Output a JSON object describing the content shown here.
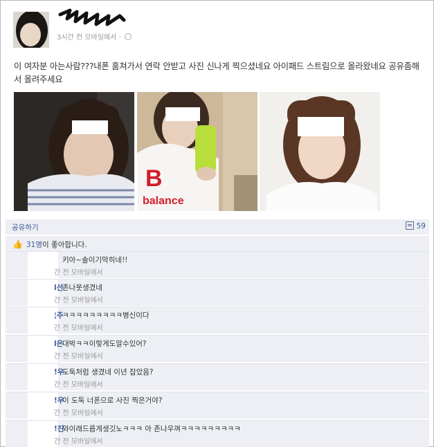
{
  "post": {
    "time_label": "3시간 전 모바일에서 · ",
    "text": "이 여자분 아는사람???내폰 훔쳐가서 연락 안받고 사진 신나게 찍으셨네요 아이패드 스트림으로 올라왔네요 공유좀해서 올려주세요"
  },
  "actions": {
    "share_label": "공유하기",
    "comment_count": "59"
  },
  "likes": {
    "count": "31명",
    "suffix": "이 좋아합니다."
  },
  "comments": [
    {
      "name": "",
      "text": "키아~솔이기막히네!!",
      "meta": "간 전 모바일에서"
    },
    {
      "name": "l선",
      "text": "존나못생겼네",
      "meta": "간 전 모바일에서"
    },
    {
      "name": "¦주",
      "text": "ㅋㅋㅋㅋㅋㅋㅋㅋㅋ병신이다",
      "meta": "간 전 모바일에서"
    },
    {
      "name": "l은",
      "text": "대박ㅋㅋ이렇게도알수있어?",
      "meta": "간 전 모바일에서"
    },
    {
      "name": "!우",
      "text": "도둑처럼 생겼네 이년 잡았음?",
      "meta": "간 전 모바일에서"
    },
    {
      "name": "!우",
      "text": "이 도둑 너폰으로 사진 찍은거야?",
      "meta": "간 전 모바일에서"
    },
    {
      "name": "!진",
      "text": "와이래드릅게생깃노ㅋㅋㅋ 아 존나우껴ㅋㅋㅋㅋㅋㅋㅋㅋㅋ",
      "meta": "간 전 모바일에서"
    }
  ]
}
